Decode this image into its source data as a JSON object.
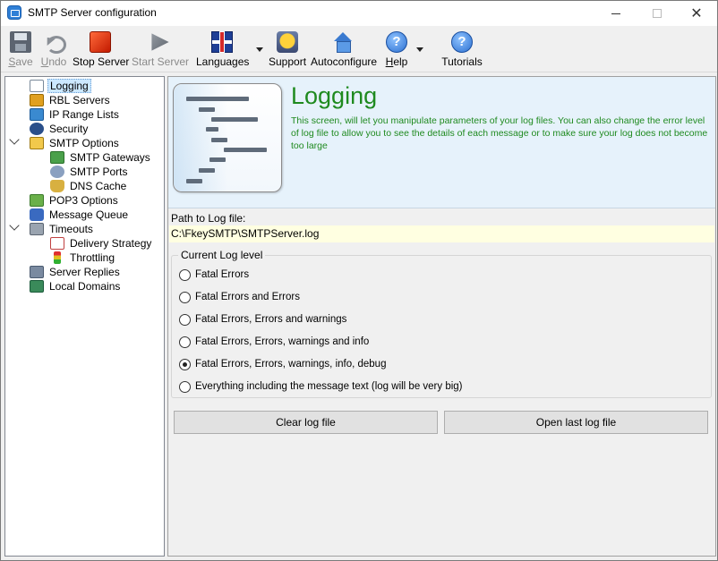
{
  "window": {
    "title": "SMTP Server configuration",
    "minimize": "—",
    "maximize": "☐",
    "close": "✕"
  },
  "toolbar": {
    "save": "Save",
    "undo": "Undo",
    "stop_server": "Stop Server",
    "start_server": "Start Server",
    "languages": "Languages",
    "support": "Support",
    "autoconfigure": "Autoconfigure",
    "help": "Help",
    "tutorials": "Tutorials",
    "help_glyph": "?"
  },
  "tree": {
    "items": [
      {
        "label": "Logging",
        "icon": "log-icon",
        "selected": true
      },
      {
        "label": "RBL Servers",
        "icon": "rbl-icon"
      },
      {
        "label": "IP Range Lists",
        "icon": "ip-range-icon"
      },
      {
        "label": "Security",
        "icon": "security-icon"
      },
      {
        "label": "SMTP Options",
        "icon": "smtp-options-icon",
        "expanded": true
      },
      {
        "label": "SMTP Gateways",
        "icon": "gateway-icon"
      },
      {
        "label": "SMTP Ports",
        "icon": "ports-icon"
      },
      {
        "label": "DNS Cache",
        "icon": "dns-icon"
      },
      {
        "label": "POP3 Options",
        "icon": "pop3-icon"
      },
      {
        "label": "Message Queue",
        "icon": "queue-icon"
      },
      {
        "label": "Timeouts",
        "icon": "timeouts-icon",
        "expanded": true
      },
      {
        "label": "Delivery Strategy",
        "icon": "calendar-icon"
      },
      {
        "label": "Throttling",
        "icon": "traffic-light-icon"
      },
      {
        "label": "Server Replies",
        "icon": "server-icon"
      },
      {
        "label": "Local Domains",
        "icon": "domain-icon"
      }
    ]
  },
  "header": {
    "title": "Logging",
    "description": "This screen, will let you manipulate parameters of your log files. You can also change the error level of log file to allow you to see the details of each message or to make sure your log does not become too large"
  },
  "log": {
    "path_label": "Path to Log file:",
    "path_value": "C:\\FkeySMTP\\SMTPServer.log",
    "level_group_title": "Current Log level",
    "levels": [
      {
        "label": "Fatal Errors",
        "checked": false
      },
      {
        "label": "Fatal Errors and Errors",
        "checked": false
      },
      {
        "label": "Fatal Errors, Errors and warnings",
        "checked": false
      },
      {
        "label": "Fatal Errors, Errors, warnings and  info",
        "checked": false
      },
      {
        "label": "Fatal Errors, Errors, warnings, info, debug",
        "checked": true
      },
      {
        "label": "Everything including the message text (log will be very big)",
        "checked": false
      }
    ],
    "clear_button": "Clear log file",
    "open_button": "Open last log file"
  },
  "colors": {
    "accent_green": "#1f8a1f",
    "header_bg": "#e6f2fb",
    "path_bg": "#ffffe1",
    "selection": "#cce8ff"
  }
}
